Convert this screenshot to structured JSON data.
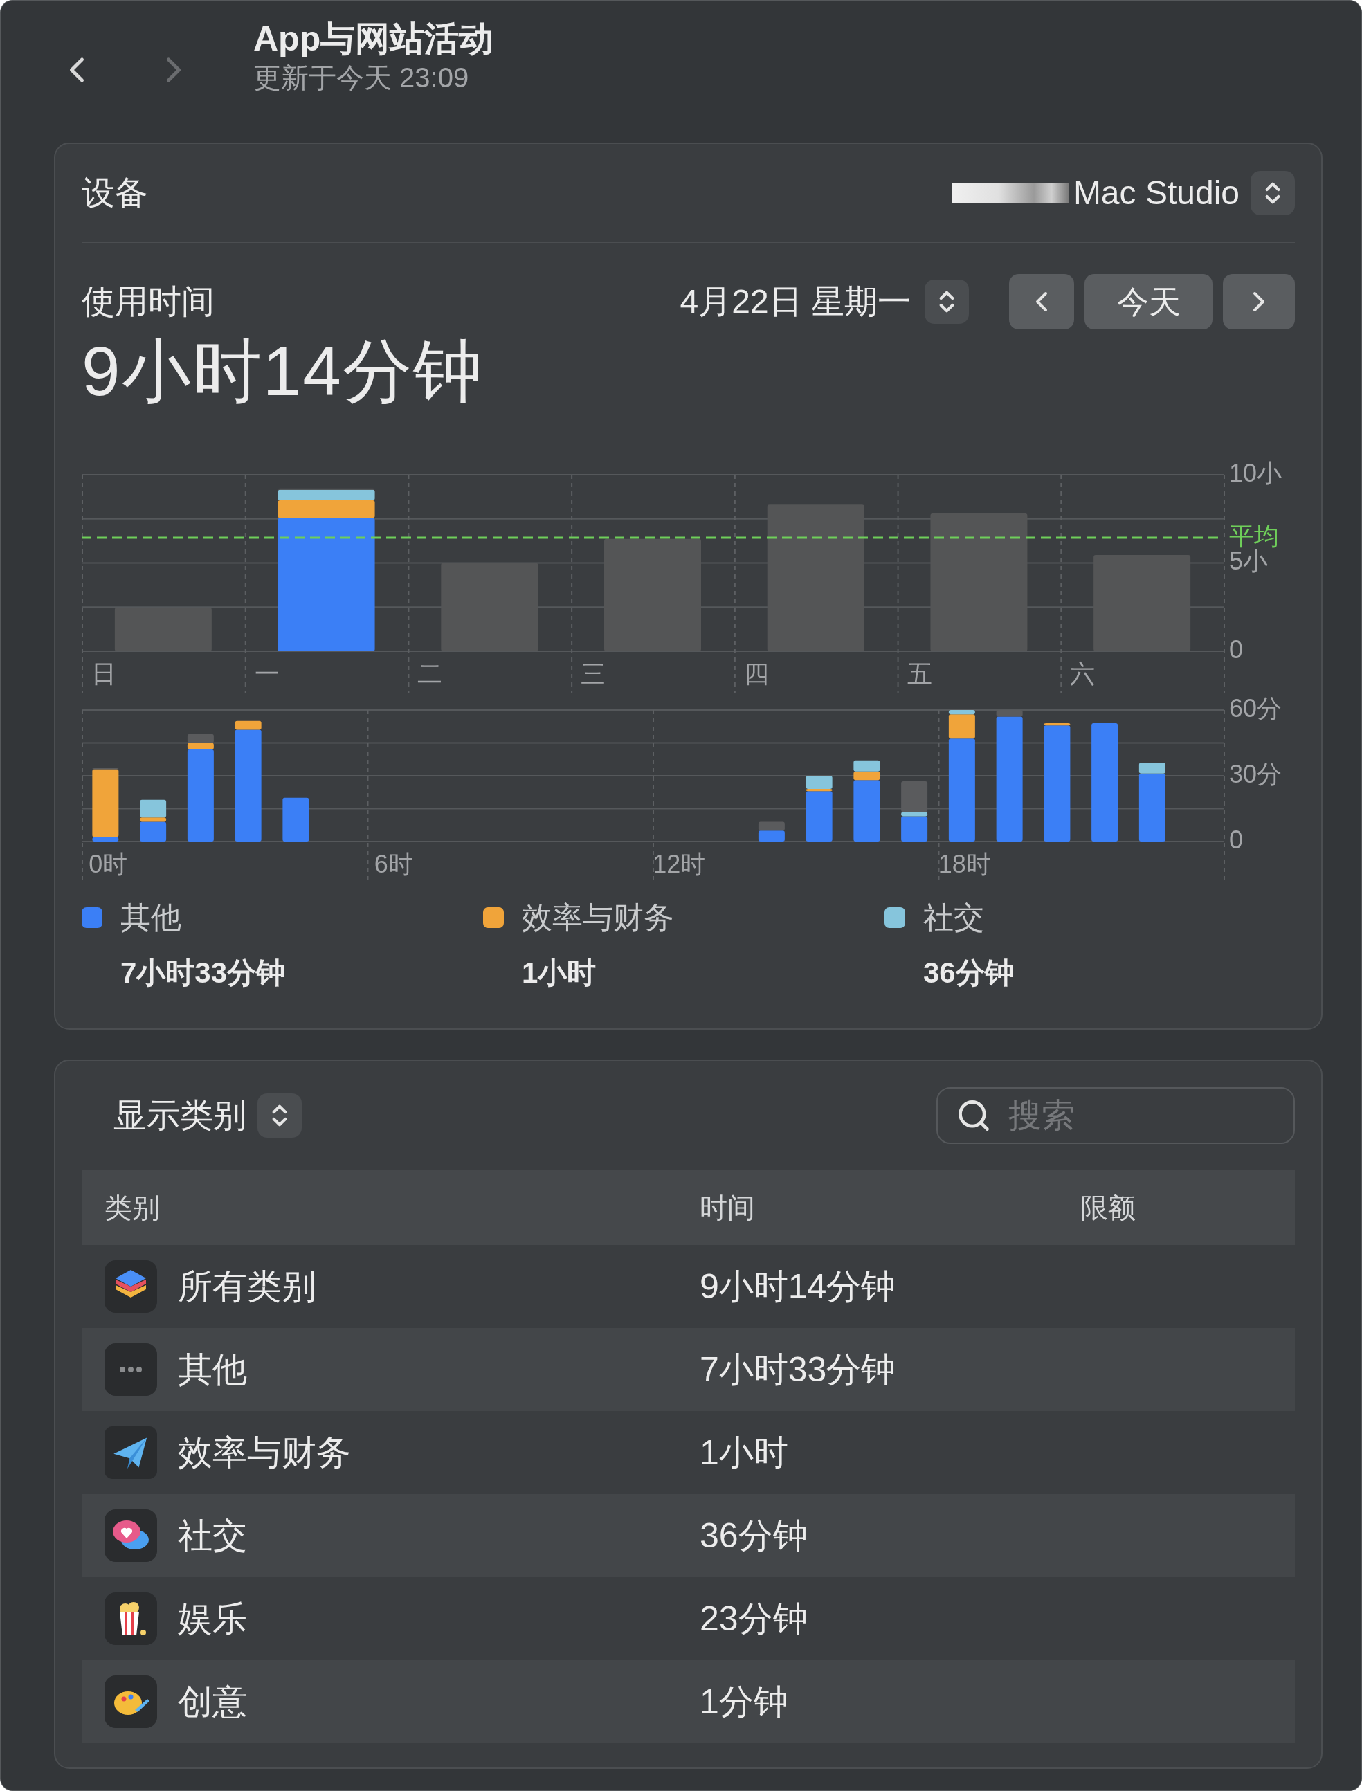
{
  "header": {
    "title": "App与网站活动",
    "subtitle": "更新于今天 23:09",
    "back_disabled": false,
    "forward_disabled": true
  },
  "device": {
    "label": "设备",
    "name": "Mac Studio"
  },
  "usage": {
    "label": "使用时间",
    "total": "9小时14分钟",
    "date": "4月22日 星期一",
    "today_button": "今天"
  },
  "weekly_chart": {
    "chart_data": {
      "type": "bar",
      "stacked": true,
      "categories": [
        "日",
        "一",
        "二",
        "三",
        "四",
        "五",
        "六"
      ],
      "series": [
        {
          "color": "#3b7ff6",
          "values": [
            null,
            7.55,
            null,
            null,
            null,
            null,
            null
          ]
        },
        {
          "color": "#f0a43a",
          "values": [
            null,
            1.0,
            null,
            null,
            null,
            null,
            null
          ]
        },
        {
          "color": "#86c5dc",
          "values": [
            null,
            0.6,
            null,
            null,
            null,
            null,
            null
          ]
        },
        {
          "color": "#545556",
          "values": [
            2.47,
            0.08,
            5.0,
            6.36,
            8.3,
            7.8,
            5.45
          ]
        }
      ],
      "ylim": [
        0,
        10
      ],
      "yticks": [
        {
          "value": 10,
          "label": "10小"
        },
        {
          "value": 5,
          "label": "5小"
        },
        {
          "value": 0,
          "label": "0"
        }
      ],
      "ref_lines": [
        {
          "axis": "y",
          "value": 6.43,
          "label": "平均"
        }
      ]
    }
  },
  "hourly_chart": {
    "chart_data": {
      "type": "bar",
      "stacked": true,
      "x": [
        0,
        1,
        2,
        3,
        4,
        5,
        6,
        7,
        8,
        9,
        10,
        11,
        12,
        13,
        14,
        15,
        16,
        17,
        18,
        19,
        20,
        21,
        22
      ],
      "xlim": [
        -0.5,
        23.5
      ],
      "series": [
        {
          "color": "#3b7ff6",
          "values": [
            2,
            9,
            42,
            51,
            20,
            null,
            null,
            null,
            null,
            null,
            null,
            null,
            null,
            null,
            5,
            23,
            28,
            11.5,
            47,
            57,
            53,
            54,
            31
          ]
        },
        {
          "color": "#f0a43a",
          "values": [
            31,
            2,
            3,
            4,
            null,
            null,
            null,
            null,
            null,
            null,
            null,
            null,
            null,
            null,
            null,
            1,
            4,
            null,
            11,
            null,
            1,
            null,
            null
          ]
        },
        {
          "color": "#86c5dc",
          "values": [
            null,
            8,
            null,
            null,
            null,
            null,
            null,
            null,
            null,
            null,
            null,
            null,
            null,
            null,
            null,
            6,
            5,
            2,
            2,
            null,
            null,
            null,
            5
          ]
        },
        {
          "color": "#5a5b5d",
          "values": [
            0.5,
            null,
            4,
            null,
            null,
            null,
            null,
            null,
            null,
            null,
            null,
            null,
            null,
            null,
            4,
            null,
            null,
            14,
            null,
            3,
            null,
            null,
            null
          ]
        }
      ],
      "xticks": [
        {
          "value": 0,
          "label": "0时"
        },
        {
          "value": 6,
          "label": "6时"
        },
        {
          "value": 12,
          "label": "12时"
        },
        {
          "value": 18,
          "label": "18时"
        }
      ],
      "ylim": [
        0,
        60
      ],
      "yticks": [
        {
          "value": 60,
          "label": "60分"
        },
        {
          "value": 30,
          "label": "30分"
        },
        {
          "value": 0,
          "label": "0"
        }
      ]
    }
  },
  "legend": [
    {
      "name": "其他",
      "color": "#3b7ff6",
      "value": "7小时33分钟"
    },
    {
      "name": "效率与财务",
      "color": "#f0a43a",
      "value": "1小时"
    },
    {
      "name": "社交",
      "color": "#86c5dc",
      "value": "36分钟"
    }
  ],
  "list": {
    "filter": "显示类别",
    "search": {
      "placeholder": "搜索"
    },
    "columns": [
      "类别",
      "时间",
      "限额"
    ],
    "rows": [
      {
        "kind": "all",
        "category": "所有类别",
        "time": "9小时14分钟"
      },
      {
        "kind": "other",
        "category": "其他",
        "time": "7小时33分钟"
      },
      {
        "kind": "productivity",
        "category": "效率与财务",
        "time": "1小时"
      },
      {
        "kind": "social",
        "category": "社交",
        "time": "36分钟"
      },
      {
        "kind": "entertainment",
        "category": "娱乐",
        "time": "23分钟"
      },
      {
        "kind": "creativity",
        "category": "创意",
        "time": "1分钟"
      }
    ]
  }
}
